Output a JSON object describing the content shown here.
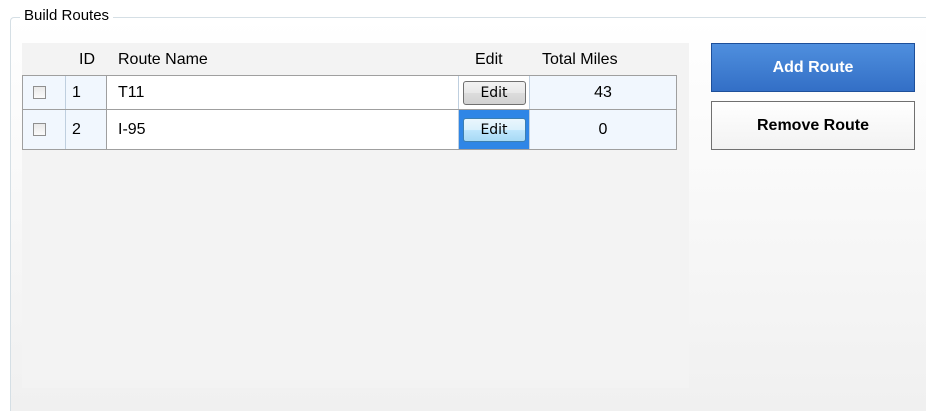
{
  "group": {
    "title": "Build Routes"
  },
  "grid": {
    "columns": {
      "id": "ID",
      "route_name": "Route Name",
      "edit": "Edit",
      "total_miles": "Total Miles"
    },
    "rows": [
      {
        "checked": false,
        "id": "1",
        "route_name": "T11",
        "edit_label": "Edit",
        "total_miles": "43"
      },
      {
        "checked": false,
        "id": "2",
        "route_name": "I-95",
        "edit_label": "Edit",
        "total_miles": "0"
      }
    ]
  },
  "actions": {
    "add_label": "Add Route",
    "remove_label": "Remove Route"
  },
  "colors": {
    "primary_button": "#336fc6",
    "focused_cell": "#2f86e6",
    "row_header_bg": "#f1f7fe"
  }
}
